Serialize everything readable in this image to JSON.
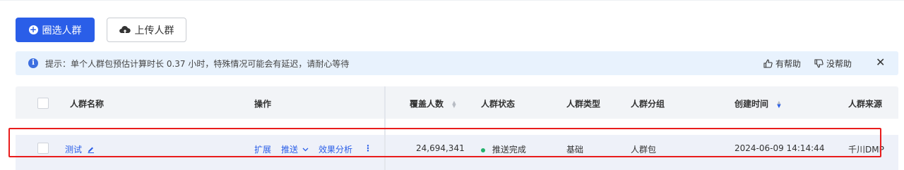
{
  "toolbar": {
    "select_crowd_label": "圈选人群",
    "upload_crowd_label": "上传人群"
  },
  "notice": {
    "text": "提示：单个人群包预估计算时长 0.37 小时，特殊情况可能会有延迟，请耐心等待",
    "helpful_label": "有帮助",
    "unhelpful_label": "没帮助",
    "close_label": "✕"
  },
  "table": {
    "headers": {
      "name": "人群名称",
      "actions": "操作",
      "coverage": "覆盖人数",
      "status": "人群状态",
      "type": "人群类型",
      "group": "人群分组",
      "created": "创建时间",
      "source": "人群来源"
    },
    "rows": [
      {
        "name": "测试",
        "action_expand": "扩展",
        "action_push": "推送",
        "action_analysis": "效果分析",
        "more": "⋮",
        "coverage": "24,694,341",
        "status": "推送完成",
        "type": "基础",
        "group": "人群包",
        "created": "2024-06-09 14:14:44",
        "source": "千川DMP"
      }
    ]
  },
  "colors": {
    "primary": "#2a5ee8",
    "status_done": "#23b26c",
    "highlight_box": "#e81c1c",
    "notice_bg": "#e8f2fd"
  }
}
